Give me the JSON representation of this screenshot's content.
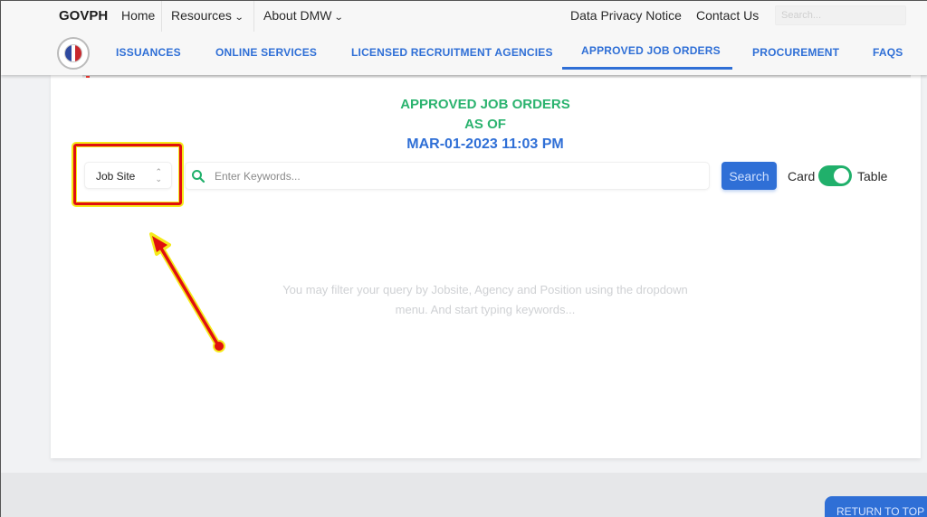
{
  "topbar": {
    "brand": "GOVPH",
    "links": [
      {
        "label": "Home"
      },
      {
        "label": "Resources",
        "has_dropdown": true
      },
      {
        "label": "About DMW",
        "has_dropdown": true
      }
    ],
    "right_links": [
      {
        "label": "Data Privacy Notice"
      },
      {
        "label": "Contact Us"
      }
    ],
    "search_placeholder": "Search..."
  },
  "mainnav": {
    "logo": "dmw-seal-logo",
    "items": [
      {
        "label": "ISSUANCES",
        "active": false
      },
      {
        "label": "ONLINE SERVICES",
        "active": false
      },
      {
        "label": "LICENSED RECRUITMENT AGENCIES",
        "active": false
      },
      {
        "label": "APPROVED JOB ORDERS",
        "active": true
      },
      {
        "label": "PROCUREMENT",
        "active": false
      },
      {
        "label": "FAQS",
        "active": false
      }
    ],
    "accent_color": "#2f6fd6"
  },
  "content": {
    "heading_line1": "APPROVED JOB ORDERS",
    "heading_line2": "AS OF",
    "heading_datetime": "MAR-01-2023 11:03 PM",
    "heading_color": "#2bb36f",
    "filter_select": {
      "selected": "Job Site"
    },
    "keyword_input": {
      "value": "",
      "placeholder": "Enter Keywords..."
    },
    "search_button": "Search",
    "view_toggle": {
      "left_label": "Card",
      "right_label": "Table",
      "state": "Table"
    },
    "hint": "You may filter your query by Jobsite, Agency and Position using the dropdown menu. And start typing keywords..."
  },
  "annotation": {
    "highlight_color": "#e00f0f",
    "glow_color": "#f5ea1a",
    "target": "Job Site dropdown"
  },
  "footer": {
    "return_to_top": "RETURN TO TOP"
  }
}
